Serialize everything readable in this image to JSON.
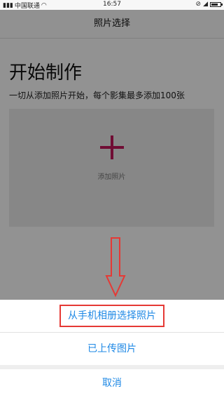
{
  "status_bar": {
    "carrier": "中国联通",
    "time": "16:57",
    "battery_level": 0.75
  },
  "header": {
    "title": "照片选择"
  },
  "main": {
    "heading": "开始制作",
    "description": "一切从添加照片开始，每个影集最多添加100张",
    "add_photo_label": "添加照片"
  },
  "action_sheet": {
    "options": [
      "从手机相册选择照片",
      "已上传图片"
    ],
    "cancel": "取消"
  },
  "colors": {
    "accent_blue": "#1e88e5",
    "highlight_red": "#e53935",
    "plus_color": "#c2185b"
  }
}
